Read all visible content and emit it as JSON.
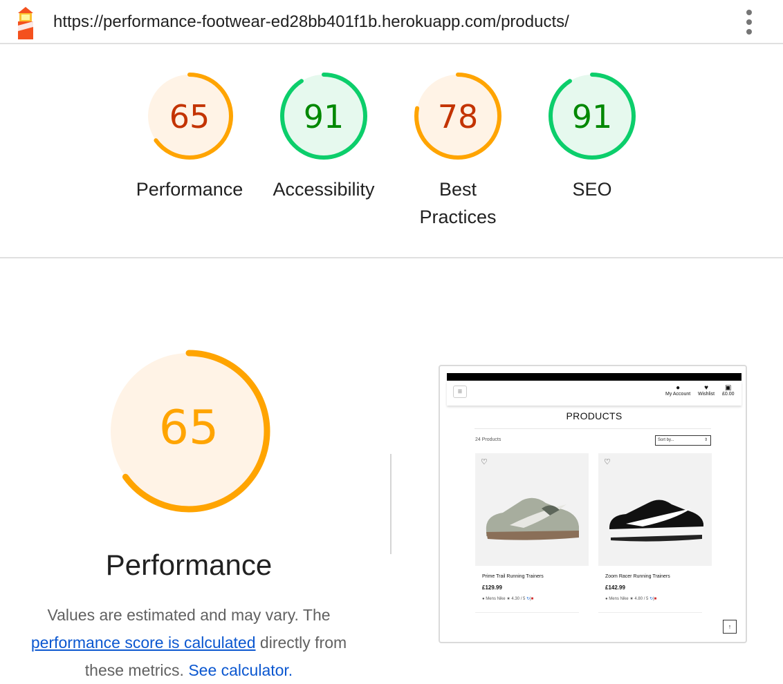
{
  "browser": {
    "url": "https://performance-footwear-ed28bb401f1b.herokuapp.com/products/"
  },
  "colors": {
    "average": "#ffa400",
    "average_bg": "#fff3e6",
    "average_text": "#c33300",
    "pass": "#0cce6b",
    "pass_bg": "#e6f9ee",
    "pass_text": "#008800",
    "link": "#0b57d0"
  },
  "scores": [
    {
      "label": "Performance",
      "value": "65",
      "score": 0.65,
      "status": "average"
    },
    {
      "label": "Accessibility",
      "value": "91",
      "score": 0.91,
      "status": "pass"
    },
    {
      "label": "Best Practices",
      "value": "78",
      "score": 0.78,
      "status": "average"
    },
    {
      "label": "SEO",
      "value": "91",
      "score": 0.91,
      "status": "pass"
    }
  ],
  "performance": {
    "value": "65",
    "score": 0.65,
    "title": "Performance",
    "desc_before": "Values are estimated and may vary. The ",
    "desc_link": "performance score is calculated",
    "desc_after": " directly from these metrics. ",
    "calc_link": "See calculator."
  },
  "screenshot": {
    "nav": {
      "account": "My Account",
      "wishlist": "Wishlist",
      "bag": "£0.00"
    },
    "heading": "PRODUCTS",
    "count": "24 Products",
    "sort": "Sort by...",
    "products": [
      {
        "name": "Prime Trail Running Trainers",
        "price": "£129.99",
        "category": "Mens",
        "brand": "Nike",
        "rating": "4.30 / 5"
      },
      {
        "name": "Zoom Racer Running Trainers",
        "price": "£142.99",
        "category": "Mens",
        "brand": "Nike",
        "rating": "4.80 / 5"
      }
    ]
  }
}
